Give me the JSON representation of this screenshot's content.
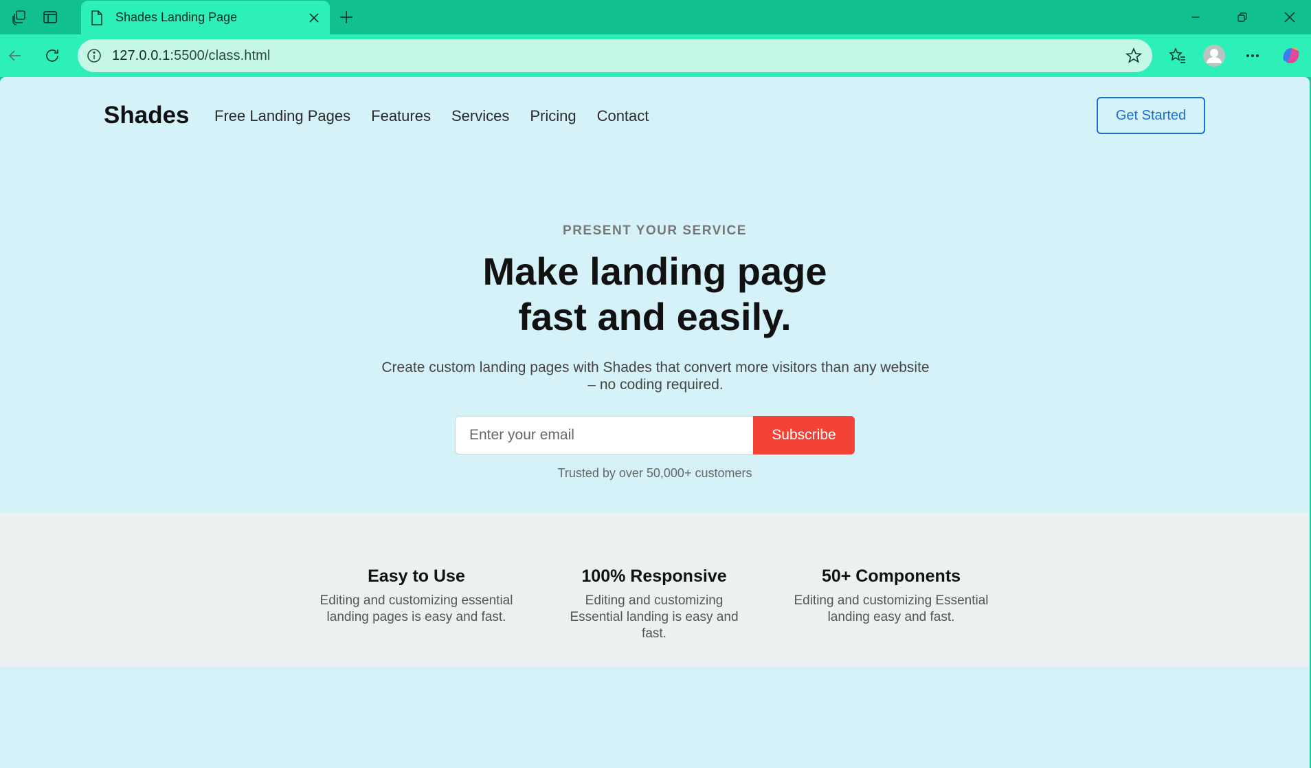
{
  "browser": {
    "tab_title": "Shades Landing Page",
    "url_host": "127.0.0.1",
    "url_rest": ":5500/class.html"
  },
  "page": {
    "logo": "Shades",
    "nav": [
      "Free Landing Pages",
      "Features",
      "Services",
      "Pricing",
      "Contact"
    ],
    "cta": "Get Started",
    "hero": {
      "eyebrow": "PRESENT YOUR SERVICE",
      "headline_line1": "Make landing page",
      "headline_line2": "fast and easily.",
      "subtitle": "Create custom landing pages with Shades that convert more visitors than any website – no coding required.",
      "email_placeholder": "Enter your email",
      "subscribe_label": "Subscribe",
      "trusted": "Trusted by over 50,000+ customers"
    },
    "features": [
      {
        "title": "Easy to Use",
        "desc": "Editing and customizing essential landing pages is easy and fast."
      },
      {
        "title": "100% Responsive",
        "desc": "Editing and customizing Essential landing is easy and fast."
      },
      {
        "title": "50+ Components",
        "desc": "Editing and customizing Essential landing easy and fast."
      }
    ]
  },
  "colors": {
    "page_bg": "#d5f2f9",
    "features_bg": "#ebf0f1",
    "cta_blue": "#1a6fd6",
    "subscribe_red": "#f44336",
    "chrome_green": "#10c08e"
  }
}
